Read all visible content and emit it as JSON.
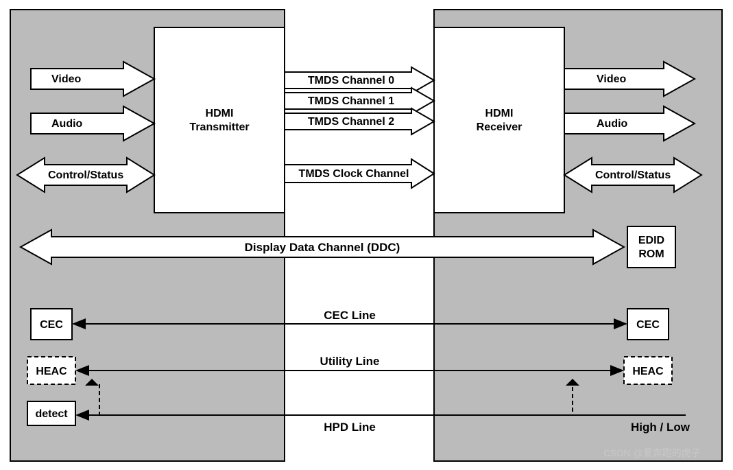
{
  "leftBlock": {
    "title1": "HDMI",
    "title2": "Transmitter",
    "inputs": [
      "Video",
      "Audio",
      "Control/Status"
    ]
  },
  "rightBlock": {
    "title1": "HDMI",
    "title2": "Receiver",
    "outputs": [
      "Video",
      "Audio",
      "Control/Status"
    ]
  },
  "channels": [
    "TMDS Channel 0",
    "TMDS Channel 1",
    "TMDS Channel 2",
    "TMDS Clock Channel"
  ],
  "ddc": {
    "label": "Display Data Channel (DDC)",
    "rom1": "EDID",
    "rom2": "ROM"
  },
  "lines": {
    "cec": "CEC Line",
    "utility": "Utility Line",
    "hpd": "HPD Line",
    "hpdLevel": "High / Low"
  },
  "boxes": {
    "cec": "CEC",
    "heac": "HEAC",
    "detect": "detect"
  },
  "watermark": "CSDN @爱奔跑的虎子"
}
